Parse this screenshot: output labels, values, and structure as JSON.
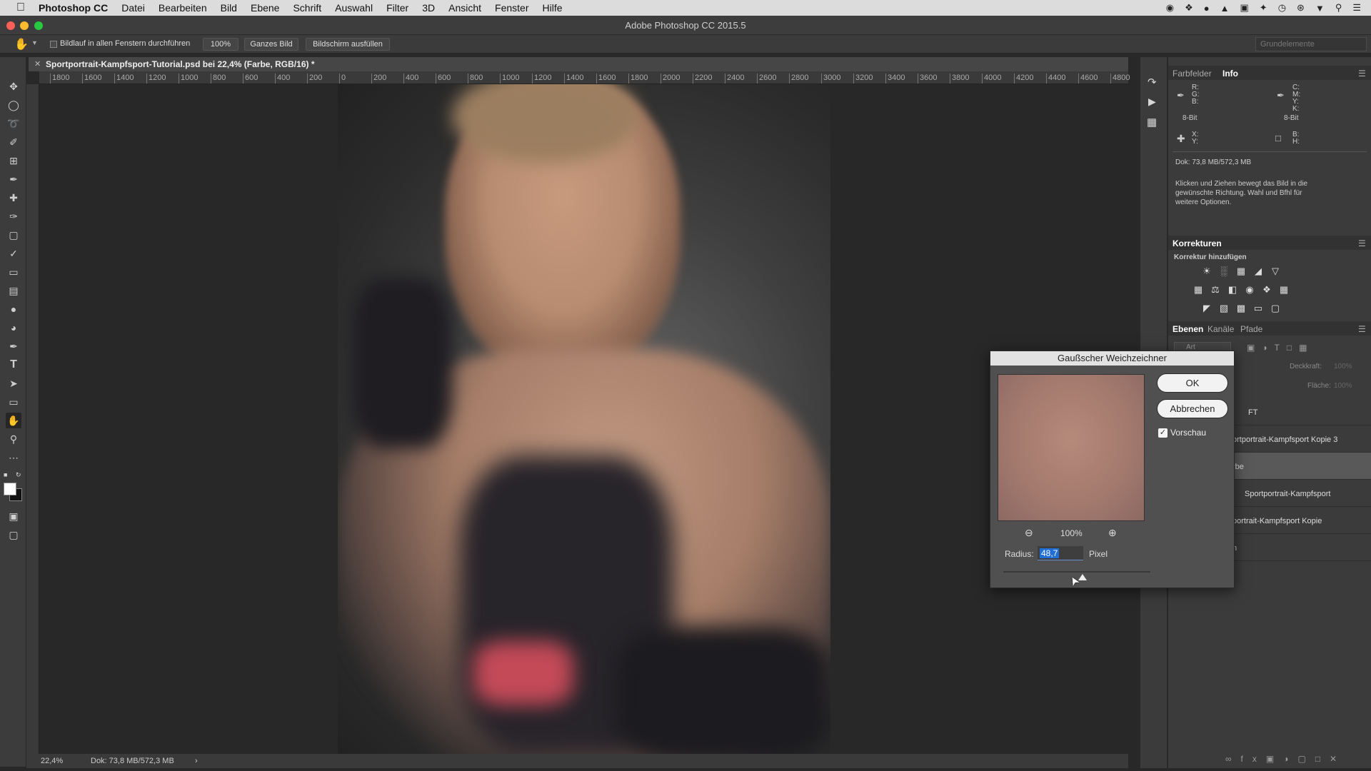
{
  "menubar": {
    "items": [
      "Photoshop CC",
      "Datei",
      "Bearbeiten",
      "Bild",
      "Ebene",
      "Schrift",
      "Auswahl",
      "Filter",
      "3D",
      "Ansicht",
      "Fenster",
      "Hilfe"
    ]
  },
  "titlebar": {
    "title": "Adobe Photoshop CC 2015.5"
  },
  "options": {
    "scroll_all_label": "Bildlauf in allen Fenstern durchführen",
    "zoom_value": "100%",
    "fit_label": "Ganzes Bild",
    "fill_label": "Bildschirm ausfüllen",
    "workspace": "Grundelemente"
  },
  "document": {
    "tab_title": "Sportportrait-Kampfsport-Tutorial.psd bei 22,4% (Farbe, RGB/16) *",
    "ruler_ticks": [
      "1800",
      "1600",
      "1400",
      "1200",
      "1000",
      "800",
      "600",
      "400",
      "200",
      "0",
      "200",
      "400",
      "600",
      "800",
      "1000",
      "1200",
      "1400",
      "1600",
      "1800",
      "2000",
      "2200",
      "2400",
      "2600",
      "2800",
      "3000",
      "3200",
      "3400",
      "3600",
      "3800",
      "4000",
      "4200",
      "4400",
      "4600",
      "4800"
    ],
    "status_zoom": "22,4%",
    "status_doc": "Dok: 73,8 MB/572,3 MB"
  },
  "info_panel": {
    "tab_swatches": "Farbfelder",
    "tab_info": "Info",
    "rgb_labels": "R:\nG:\nB:",
    "cmyk_labels": "C:\nM:\nY:\nK:",
    "bit_left": "8-Bit",
    "bit_right": "8-Bit",
    "xy_labels": "X:\nY:",
    "wh_labels": "B:\nH:",
    "doc_size": "Dok: 73,8 MB/572,3 MB",
    "hint": "Klicken und Ziehen bewegt das Bild in die gewünschte Richtung. Wahl und Bfhl für weitere Optionen."
  },
  "adjustments_panel": {
    "title": "Korrekturen",
    "subtitle": "Korrektur hinzufügen"
  },
  "layers_panel": {
    "tab_layers": "Ebenen",
    "tab_channels": "Kanäle",
    "tab_paths": "Pfade",
    "search_kind": "Art",
    "opacity_label": "Deckkraft:",
    "opacity_value": "100%",
    "fill_label": "Fläche:",
    "fill_value": "100%",
    "layers": [
      "FT",
      "ortportrait-Kampfsport Kopie 3",
      "rbe",
      "Sportportrait-Kampfsport",
      "portrait-Kampfsport Kopie",
      "n"
    ]
  },
  "dialog": {
    "title": "Gaußscher Weichzeichner",
    "ok": "OK",
    "cancel": "Abbrechen",
    "preview_label": "Vorschau",
    "preview_checked": true,
    "zoom": "100%",
    "radius_label": "Radius:",
    "radius_value": "48,7",
    "radius_unit": "Pixel",
    "radius_slider_fraction": 0.54
  },
  "colors": {
    "accent": "#1f6fd6",
    "panel_bg": "#3b3b3b",
    "dialog_bg": "#505050"
  }
}
